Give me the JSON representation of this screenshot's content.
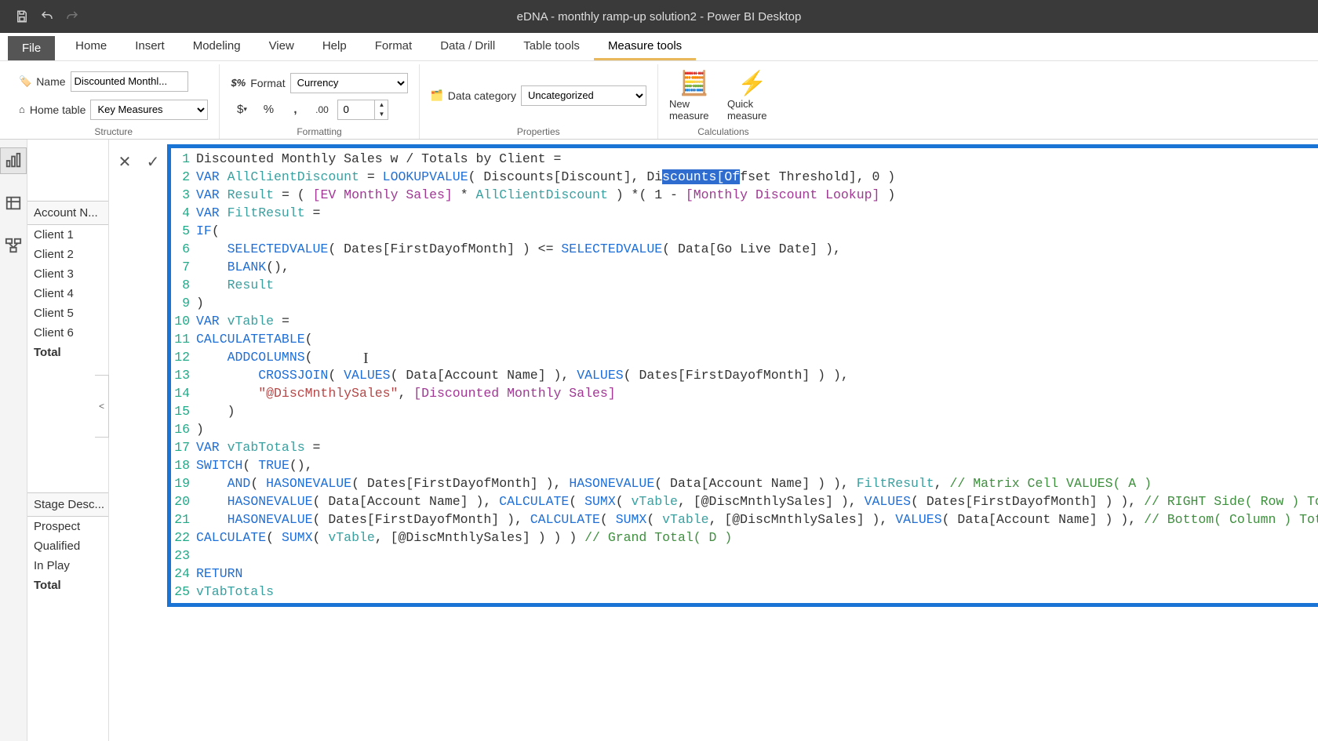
{
  "titlebar": {
    "title": "eDNA - monthly ramp-up solution2 - Power BI Desktop"
  },
  "menu": {
    "file": "File",
    "tabs": [
      "Home",
      "Insert",
      "Modeling",
      "View",
      "Help",
      "Format",
      "Data / Drill",
      "Table tools",
      "Measure tools"
    ],
    "active_index": 8
  },
  "ribbon": {
    "structure": {
      "name_label": "Name",
      "name_value": "Discounted Monthl...",
      "hometable_label": "Home table",
      "hometable_value": "Key Measures",
      "group_label": "Structure"
    },
    "formatting": {
      "format_label": "Format",
      "format_value": "Currency",
      "decimals_value": "0",
      "group_label": "Formatting"
    },
    "properties": {
      "datacat_label": "Data category",
      "datacat_value": "Uncategorized",
      "group_label": "Properties"
    },
    "calculations": {
      "new_measure": "New measure",
      "quick_measure": "Quick measure",
      "group_label": "Calculations"
    }
  },
  "side1": {
    "header": "Account N...",
    "rows": [
      "Client 1",
      "Client 2",
      "Client 3",
      "Client 4",
      "Client 5",
      "Client 6"
    ],
    "total": "Total"
  },
  "side2": {
    "header": "Stage Desc...",
    "rows": [
      "Prospect",
      "Qualified",
      "In Play"
    ],
    "total": "Total"
  },
  "code": {
    "lines": [
      {
        "n": 1,
        "segs": [
          [
            "",
            "Discounted Monthly Sales w / Totals by Client ="
          ]
        ]
      },
      {
        "n": 2,
        "segs": [
          [
            "kw-var",
            "VAR"
          ],
          [
            "",
            " "
          ],
          [
            "kw-ident",
            "AllClientDiscount"
          ],
          [
            "",
            " = "
          ],
          [
            "kw-func",
            "LOOKUPVALUE"
          ],
          [
            "",
            "( Discounts[Discount], Di"
          ],
          [
            "sel",
            "scounts[Of"
          ],
          [
            "",
            "fset Threshold], 0 )"
          ]
        ]
      },
      {
        "n": 3,
        "segs": [
          [
            "kw-var",
            "VAR"
          ],
          [
            "",
            " "
          ],
          [
            "kw-ident",
            "Result"
          ],
          [
            "",
            " = ( "
          ],
          [
            "kw-ref",
            "[EV Monthly Sales]"
          ],
          [
            "",
            " * "
          ],
          [
            "kw-ident",
            "AllClientDiscount"
          ],
          [
            "",
            " ) *( 1 - "
          ],
          [
            "kw-ref",
            "[Monthly Discount Lookup]"
          ],
          [
            "",
            " )"
          ]
        ]
      },
      {
        "n": 4,
        "segs": [
          [
            "kw-var",
            "VAR"
          ],
          [
            "",
            " "
          ],
          [
            "kw-ident",
            "FiltResult"
          ],
          [
            "",
            " ="
          ]
        ]
      },
      {
        "n": 5,
        "segs": [
          [
            "kw-func",
            "IF"
          ],
          [
            "",
            "("
          ]
        ]
      },
      {
        "n": 6,
        "segs": [
          [
            "",
            "    "
          ],
          [
            "kw-func",
            "SELECTEDVALUE"
          ],
          [
            "",
            "( Dates[FirstDayofMonth] ) <= "
          ],
          [
            "kw-func",
            "SELECTEDVALUE"
          ],
          [
            "",
            "( Data[Go Live Date] ),"
          ]
        ]
      },
      {
        "n": 7,
        "segs": [
          [
            "",
            "    "
          ],
          [
            "kw-func",
            "BLANK"
          ],
          [
            "",
            "(),"
          ]
        ]
      },
      {
        "n": 8,
        "segs": [
          [
            "",
            "    "
          ],
          [
            "kw-ident",
            "Result"
          ]
        ]
      },
      {
        "n": 9,
        "segs": [
          [
            "",
            ")"
          ]
        ]
      },
      {
        "n": 10,
        "segs": [
          [
            "kw-var",
            "VAR"
          ],
          [
            "",
            " "
          ],
          [
            "kw-ident",
            "vTable"
          ],
          [
            "",
            " ="
          ]
        ]
      },
      {
        "n": 11,
        "segs": [
          [
            "kw-func",
            "CALCULATETABLE"
          ],
          [
            "",
            "("
          ]
        ]
      },
      {
        "n": 12,
        "segs": [
          [
            "",
            "    "
          ],
          [
            "kw-func",
            "ADDCOLUMNS"
          ],
          [
            "",
            "("
          ]
        ]
      },
      {
        "n": 13,
        "segs": [
          [
            "",
            "        "
          ],
          [
            "kw-func",
            "CROSSJOIN"
          ],
          [
            "",
            "( "
          ],
          [
            "kw-func",
            "VALUES"
          ],
          [
            "",
            "( Data[Account Name] ), "
          ],
          [
            "kw-func",
            "VALUES"
          ],
          [
            "",
            "( Dates[FirstDayofMonth] ) ),"
          ]
        ]
      },
      {
        "n": 14,
        "segs": [
          [
            "",
            "        "
          ],
          [
            "kw-str",
            "\"@DiscMnthlySales\""
          ],
          [
            "",
            ", "
          ],
          [
            "kw-ref",
            "[Discounted Monthly Sales]"
          ]
        ]
      },
      {
        "n": 15,
        "segs": [
          [
            "",
            "    )"
          ]
        ]
      },
      {
        "n": 16,
        "segs": [
          [
            "",
            ")"
          ]
        ]
      },
      {
        "n": 17,
        "segs": [
          [
            "kw-var",
            "VAR"
          ],
          [
            "",
            " "
          ],
          [
            "kw-ident",
            "vTabTotals"
          ],
          [
            "",
            " ="
          ]
        ]
      },
      {
        "n": 18,
        "segs": [
          [
            "kw-func",
            "SWITCH"
          ],
          [
            "",
            "( "
          ],
          [
            "kw-func",
            "TRUE"
          ],
          [
            "",
            "(),"
          ]
        ]
      },
      {
        "n": 19,
        "segs": [
          [
            "",
            "    "
          ],
          [
            "kw-func",
            "AND"
          ],
          [
            "",
            "( "
          ],
          [
            "kw-func",
            "HASONEVALUE"
          ],
          [
            "",
            "( Dates[FirstDayofMonth] ), "
          ],
          [
            "kw-func",
            "HASONEVALUE"
          ],
          [
            "",
            "( Data[Account Name] ) ), "
          ],
          [
            "kw-ident",
            "FiltResult"
          ],
          [
            "",
            ", "
          ],
          [
            "kw-com",
            "// Matrix Cell VALUES( A )"
          ]
        ]
      },
      {
        "n": 20,
        "segs": [
          [
            "",
            "    "
          ],
          [
            "kw-func",
            "HASONEVALUE"
          ],
          [
            "",
            "( Data[Account Name] ), "
          ],
          [
            "kw-func",
            "CALCULATE"
          ],
          [
            "",
            "( "
          ],
          [
            "kw-func",
            "SUMX"
          ],
          [
            "",
            "( "
          ],
          [
            "kw-ident",
            "vTable"
          ],
          [
            "",
            ", [@DiscMnthlySales] ), "
          ],
          [
            "kw-func",
            "VALUES"
          ],
          [
            "",
            "( Dates[FirstDayofMonth] ) ), "
          ],
          [
            "kw-com",
            "// RIGHT Side( Row ) Totals( B )"
          ]
        ]
      },
      {
        "n": 21,
        "segs": [
          [
            "",
            "    "
          ],
          [
            "kw-func",
            "HASONEVALUE"
          ],
          [
            "",
            "( Dates[FirstDayofMonth] ), "
          ],
          [
            "kw-func",
            "CALCULATE"
          ],
          [
            "",
            "( "
          ],
          [
            "kw-func",
            "SUMX"
          ],
          [
            "",
            "( "
          ],
          [
            "kw-ident",
            "vTable"
          ],
          [
            "",
            ", [@DiscMnthlySales] ), "
          ],
          [
            "kw-func",
            "VALUES"
          ],
          [
            "",
            "( Data[Account Name] ) ), "
          ],
          [
            "kw-com",
            "// Bottom( Column ) Totals( C )"
          ]
        ]
      },
      {
        "n": 22,
        "segs": [
          [
            "kw-func",
            "CALCULATE"
          ],
          [
            "",
            "( "
          ],
          [
            "kw-func",
            "SUMX"
          ],
          [
            "",
            "( "
          ],
          [
            "kw-ident",
            "vTable"
          ],
          [
            "",
            ", [@DiscMnthlySales] ) ) ) "
          ],
          [
            "kw-com",
            "// Grand Total( D )"
          ]
        ]
      },
      {
        "n": 23,
        "segs": [
          [
            "",
            ""
          ]
        ]
      },
      {
        "n": 24,
        "segs": [
          [
            "kw-func",
            "RETURN"
          ]
        ]
      },
      {
        "n": 25,
        "segs": [
          [
            "kw-ident",
            "vTabTotals"
          ]
        ]
      }
    ]
  }
}
